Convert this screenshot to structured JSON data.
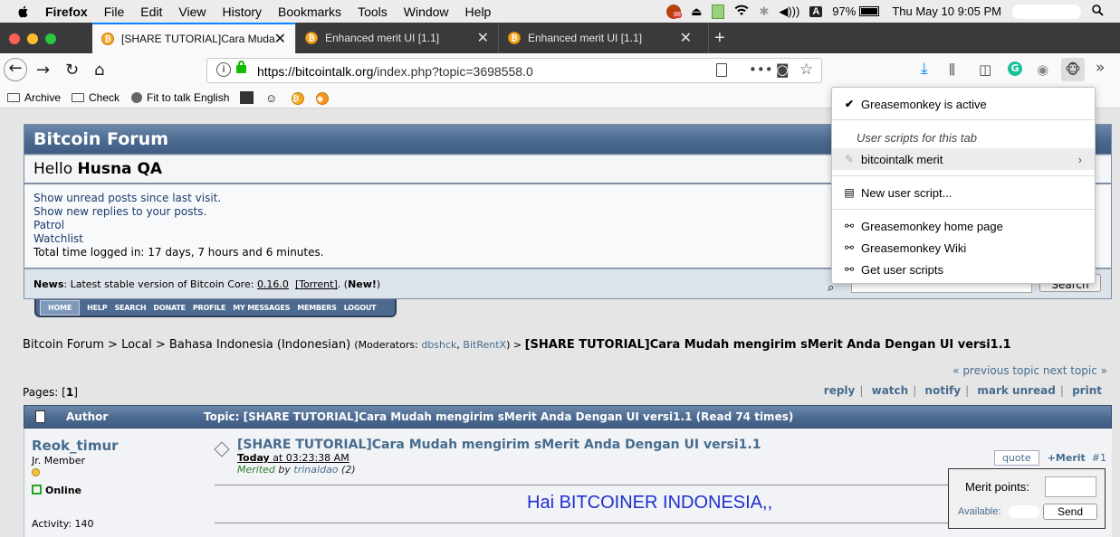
{
  "menubar": {
    "app": "Firefox",
    "items": [
      "File",
      "Edit",
      "View",
      "History",
      "Bookmarks",
      "Tools",
      "Window",
      "Help"
    ],
    "badge": "88",
    "battery": "97%",
    "clock": "Thu May 10  9:05 PM",
    "input_source": "A"
  },
  "tabs": [
    {
      "title": "[SHARE TUTORIAL]Cara Mudah",
      "active": true
    },
    {
      "title": "Enhanced merit UI [1.1]",
      "active": false
    },
    {
      "title": "Enhanced merit UI [1.1]",
      "active": false
    }
  ],
  "newtab": "+",
  "url": {
    "host": "https://bitcointalk.org",
    "path": "/index.php?topic=3698558.0"
  },
  "bookmarks": [
    {
      "label": "Archive",
      "icon": "folder-icon"
    },
    {
      "label": "Check",
      "icon": "folder-icon"
    },
    {
      "label": "Fit to talk English",
      "icon": "globe-icon"
    }
  ],
  "forum": {
    "title": "Bitcoin Forum",
    "hello_prefix": "Hello ",
    "username": "Husna QA",
    "links": [
      "Show unread posts since last visit.",
      "Show new replies to your posts.",
      "Patrol",
      "Watchlist"
    ],
    "time_logged": "Total time logged in: 17 days, 7 hours and 6 minutes.",
    "news_label": "News",
    "news_text": ": Latest stable version of Bitcoin Core: ",
    "news_version": "0.16.0",
    "news_torrent": "[Torrent]",
    "news_new": "New!",
    "search_button": "Search",
    "menu": [
      "HOME",
      "HELP",
      "SEARCH",
      "DONATE",
      "PROFILE",
      "MY MESSAGES",
      "MEMBERS",
      "LOGOUT"
    ]
  },
  "breadcrumb": {
    "path": "Bitcoin Forum > Local > Bahasa Indonesia (Indonesian) ",
    "mod_prefix": "(Moderators: ",
    "mod1": "dbshck",
    "mod_sep": ", ",
    "mod2": "BitRentX",
    "mod_suffix": ") > ",
    "current": "[SHARE TUTORIAL]Cara Mudah mengirim sMerit Anda Dengan UI versi1.1"
  },
  "nav": {
    "prevnext": "« previous topic next topic »",
    "pages_label": "Pages: [",
    "pages_current": "1",
    "pages_end": "]",
    "actions": [
      "reply",
      "watch",
      "notify",
      "mark unread",
      "print"
    ]
  },
  "topic_header": {
    "author_col": "Author",
    "topic_col": "Topic: [SHARE TUTORIAL]Cara Mudah mengirim sMerit Anda Dengan UI versi1.1  (Read 74 times)"
  },
  "post": {
    "author": "Reok_timur",
    "rank": "Jr. Member",
    "status": "Online",
    "activity": "Activity: 140",
    "title": "[SHARE TUTORIAL]Cara Mudah mengirim sMerit Anda Dengan UI versi1.1",
    "date_bold": "Today",
    "date_rest": " at 03:23:38 AM",
    "merited_prefix": "Merited",
    "merited_by": " by ",
    "merited_user": "trinaldao",
    "merited_count": " (2)",
    "quote": "quote",
    "merit": "+Merit",
    "number": "#1",
    "greeting": "Hai BITCOINER INDONESIA,,"
  },
  "merit_panel": {
    "points_label": "Merit points:",
    "available_label": "Available:",
    "send": "Send"
  },
  "greasemonkey": {
    "active": "Greasemonkey is active",
    "section": "User scripts for this tab",
    "script": "bitcointalk merit",
    "new_script": "New user script...",
    "home": "Greasemonkey home page",
    "wiki": "Greasemonkey Wiki",
    "get": "Get user scripts"
  },
  "colors": {
    "forum_header": "#4c6a90",
    "link": "#476c8e",
    "tab_accent": "#0a84ff",
    "greeting": "#1e2fd0"
  }
}
